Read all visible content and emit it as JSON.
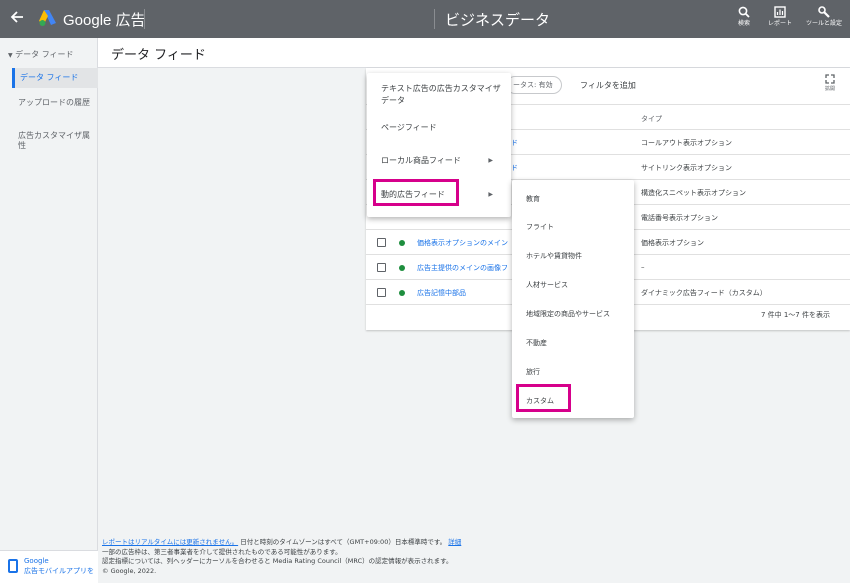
{
  "topbar": {
    "back_icon": "arrow-left-icon",
    "brand": "Google 広告",
    "page": "ビジネスデータ",
    "tools": [
      {
        "icon": "search-icon",
        "label": "検索"
      },
      {
        "icon": "report-icon",
        "label": "レポート"
      },
      {
        "icon": "wrench-icon",
        "label": "ツールと設定"
      }
    ]
  },
  "page_title": "データ フィード",
  "sidebar": {
    "section": "データ フィード",
    "items": [
      {
        "label": "データ フィード"
      },
      {
        "label": "アップロードの履歴"
      },
      {
        "label": "広告カスタマイザ属性"
      }
    ],
    "footer": {
      "line1": "Google",
      "line2": "広告モバイルアプリを"
    }
  },
  "filter": {
    "chip": "ータス: 有効",
    "add": "フィルタを追加",
    "expand_label": "拡開"
  },
  "table": {
    "type_header": "タイプ",
    "rows": [
      {
        "name": "ド",
        "type": "コールアウト表示オプション",
        "show_controls": false
      },
      {
        "name": "ド",
        "type": "サイトリンク表示オプション",
        "show_controls": false
      },
      {
        "name": "",
        "type": "構造化スニペット表示オプション",
        "show_controls": false
      },
      {
        "name": "",
        "type": "電話番号表示オプション",
        "show_controls": false
      },
      {
        "name": "価格表示オプションのメイン",
        "type": "価格表示オプション",
        "show_controls": true
      },
      {
        "name": "広告主提供のメインの画像フ",
        "type": "–",
        "show_controls": true
      },
      {
        "name": "広告記憶中部品",
        "type": "ダイナミック広告フィード（カスタム）",
        "show_controls": true
      }
    ],
    "pager": "7 件中 1〜7 件を表示"
  },
  "menu1": {
    "items": [
      {
        "label": "テキスト広告の広告カスタマイザ データ",
        "submenu": false
      },
      {
        "label": "ページフィード",
        "submenu": false
      },
      {
        "label": "ローカル商品フィード",
        "submenu": true
      },
      {
        "label": "動的広告フィード",
        "submenu": true
      }
    ]
  },
  "menu2": {
    "items": [
      "教育",
      "フライト",
      "ホテルや賃貸物件",
      "人材サービス",
      "地域限定の商品やサービス",
      "不動産",
      "旅行",
      "カスタム"
    ]
  },
  "footer": {
    "link1": "レポートはリアルタイムには更新されません。",
    "text1": "日付と時刻のタイムゾーンはすべて（GMT+09:00）日本標準時です。",
    "link2": "詳細",
    "line2": "一部の広告枠は、第三者事業者を介して提供されたものである可能性があります。",
    "line3": "認定指標については、列ヘッダーにカーソルを合わせると Media Rating Council（MRC）の認定情報が表示されます。",
    "line4": "© Google, 2022."
  },
  "colors": {
    "accent": "#1a73e8",
    "highlight": "#d6008b",
    "topbar": "#5f6368",
    "status": "#1e8e3e"
  }
}
